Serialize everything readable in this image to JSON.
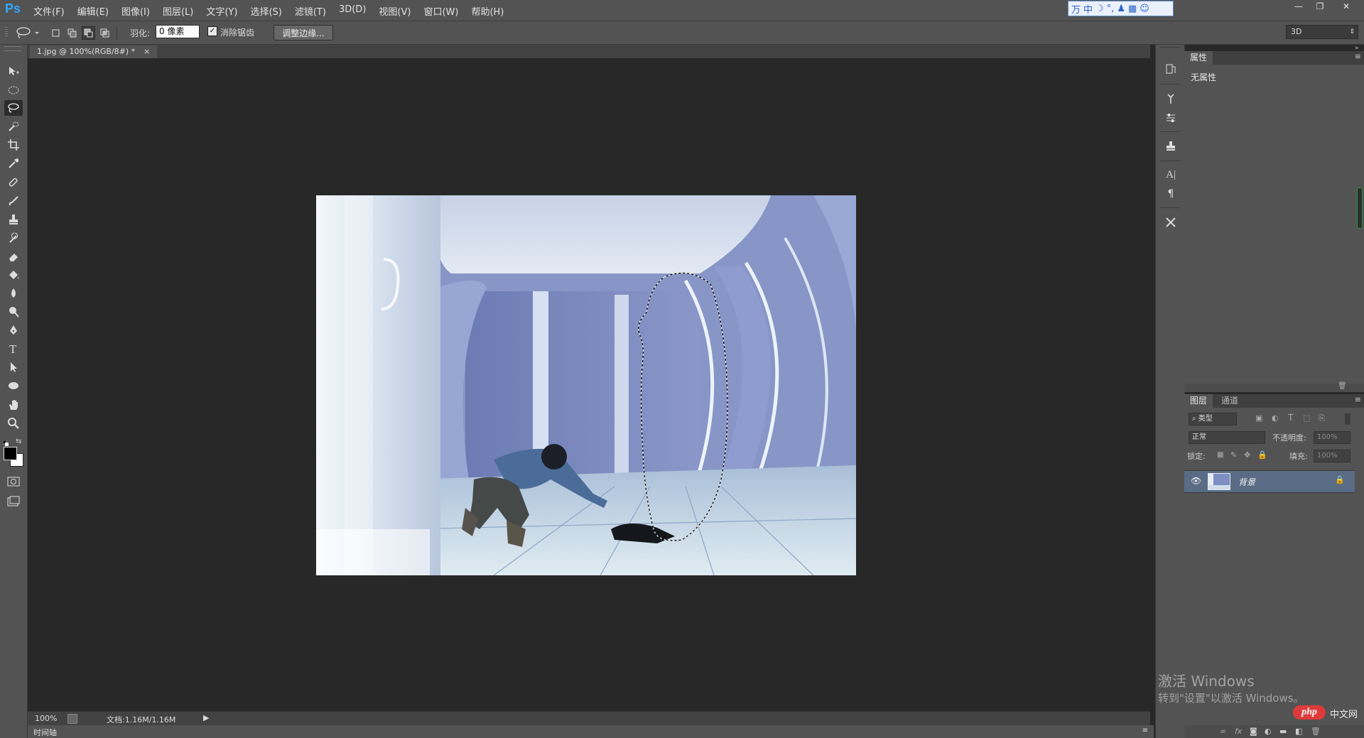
{
  "app": {
    "logo": "Ps"
  },
  "menu": [
    "文件(F)",
    "编辑(E)",
    "图像(I)",
    "图层(L)",
    "文字(Y)",
    "选择(S)",
    "滤镜(T)",
    "3D(D)",
    "视图(V)",
    "窗口(W)",
    "帮助(H)"
  ],
  "ime": {
    "items": [
      "万",
      "中",
      "☽",
      "°,",
      "♟",
      "▦",
      "☺"
    ]
  },
  "window_controls": [
    "—",
    "❐",
    "✕"
  ],
  "options": {
    "feather_label": "羽化:",
    "feather_value": "0 像素",
    "antialias_label": "消除锯齿",
    "antialias_checked": true,
    "refine_edge": "调整边缘...",
    "workspace": "3D"
  },
  "document": {
    "tab_title": "1.jpg @ 100%(RGB/8#) *",
    "tab_close": "×"
  },
  "status": {
    "zoom": "100%",
    "doc_size": "文档:1.16M/1.16M"
  },
  "timeline_label": "时间轴",
  "properties_panel": {
    "tab": "属性",
    "content": "无属性"
  },
  "layers_panel": {
    "tabs": [
      "图层",
      "通道"
    ],
    "filter_kind": "类型",
    "blend_mode": "正常",
    "opacity_label": "不透明度:",
    "opacity_value": "100%",
    "lock_label": "锁定:",
    "fill_label": "填充:",
    "fill_value": "100%",
    "layers": [
      {
        "name": "背景",
        "visible": true,
        "locked": true
      }
    ]
  },
  "watermark": {
    "line1": "激活 Windows",
    "line2": "转到\"设置\"以激活 Windows。"
  },
  "site_logo": {
    "badge": "php",
    "text": "中文网"
  },
  "colors": {
    "accent": "#31a8ff",
    "selected_layer": "#596b85",
    "panel_bg": "#535353",
    "canvas_bg": "#282828"
  }
}
